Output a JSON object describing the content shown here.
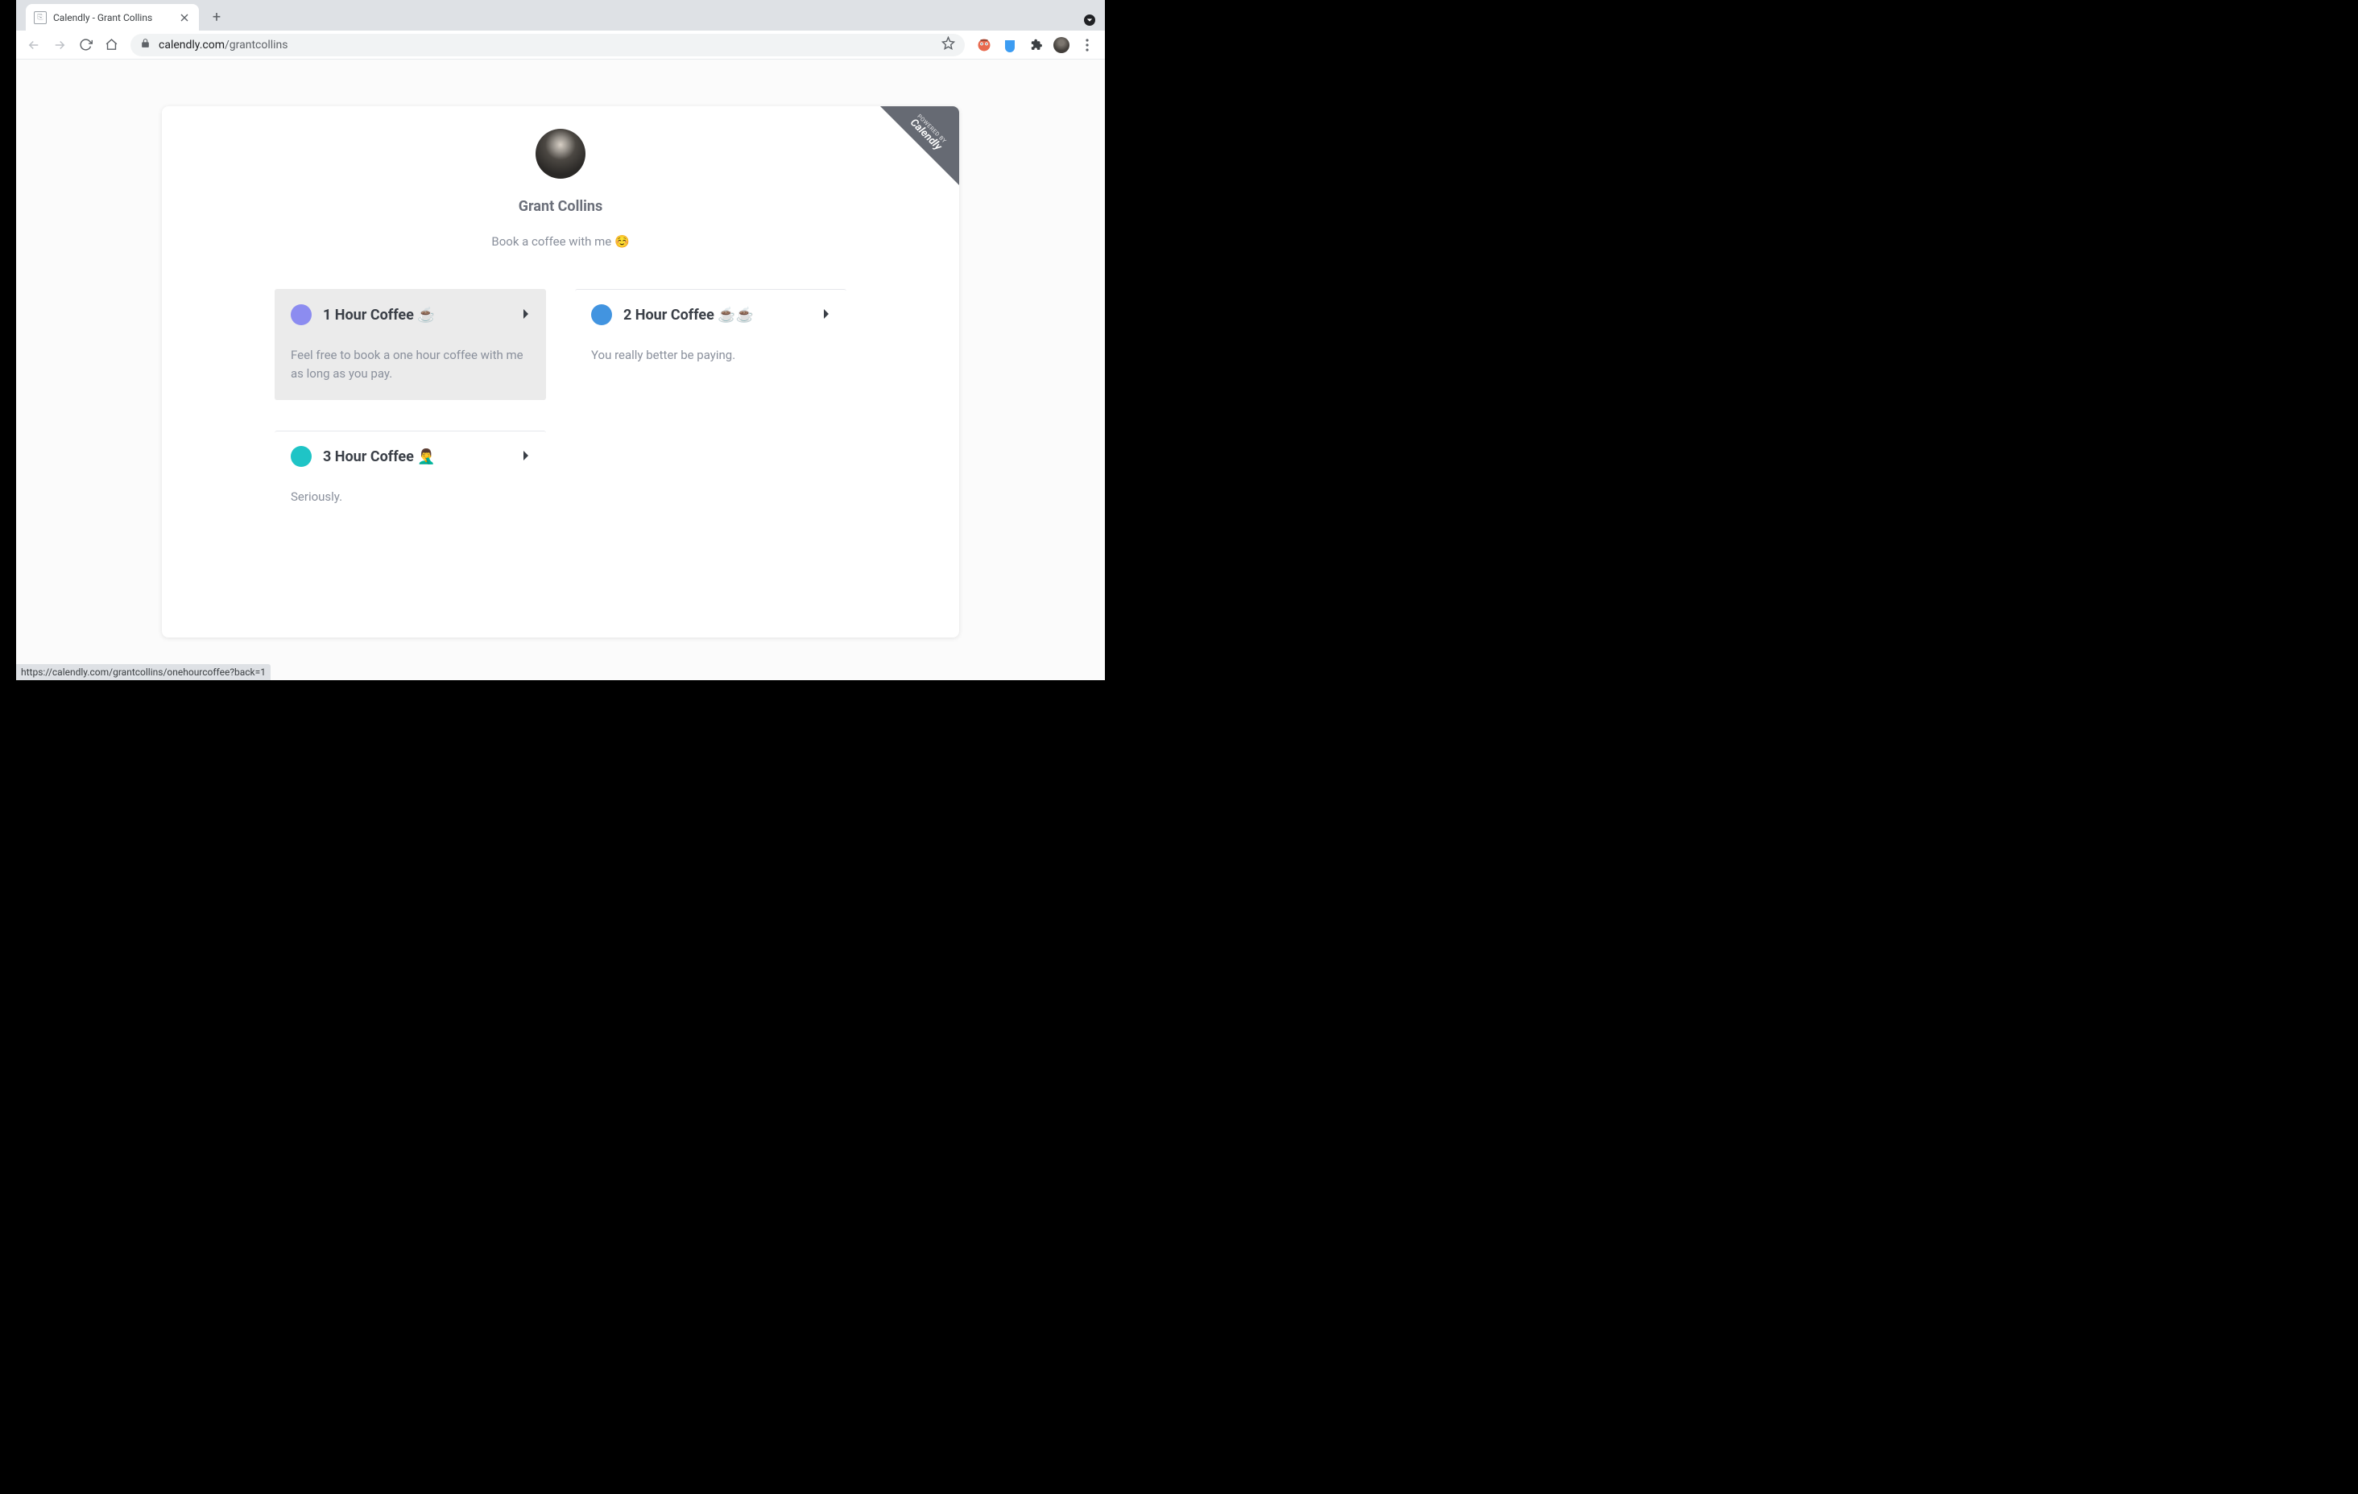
{
  "browser": {
    "tab_title": "Calendly - Grant Collins",
    "url_domain": "calendly.com",
    "url_path": "/grantcollins",
    "status_url": "https://calendly.com/grantcollins/onehourcoffee?back=1"
  },
  "corner_badge": {
    "powered": "POWERED BY",
    "brand": "Calendly"
  },
  "profile": {
    "name": "Grant Collins",
    "bio": "Book a coffee with me ☺️"
  },
  "events": [
    {
      "title": "1 Hour Coffee ☕",
      "desc": "Feel free to book a one hour coffee with me as long as you pay.",
      "color": "#8c8cf0",
      "hovered": true
    },
    {
      "title": "2 Hour Coffee ☕☕",
      "desc": "You really better be paying.",
      "color": "#4294e0",
      "hovered": false
    },
    {
      "title": "3 Hour Coffee 🤦‍♂️",
      "desc": "Seriously.",
      "color": "#1fc4c6",
      "hovered": false
    }
  ]
}
